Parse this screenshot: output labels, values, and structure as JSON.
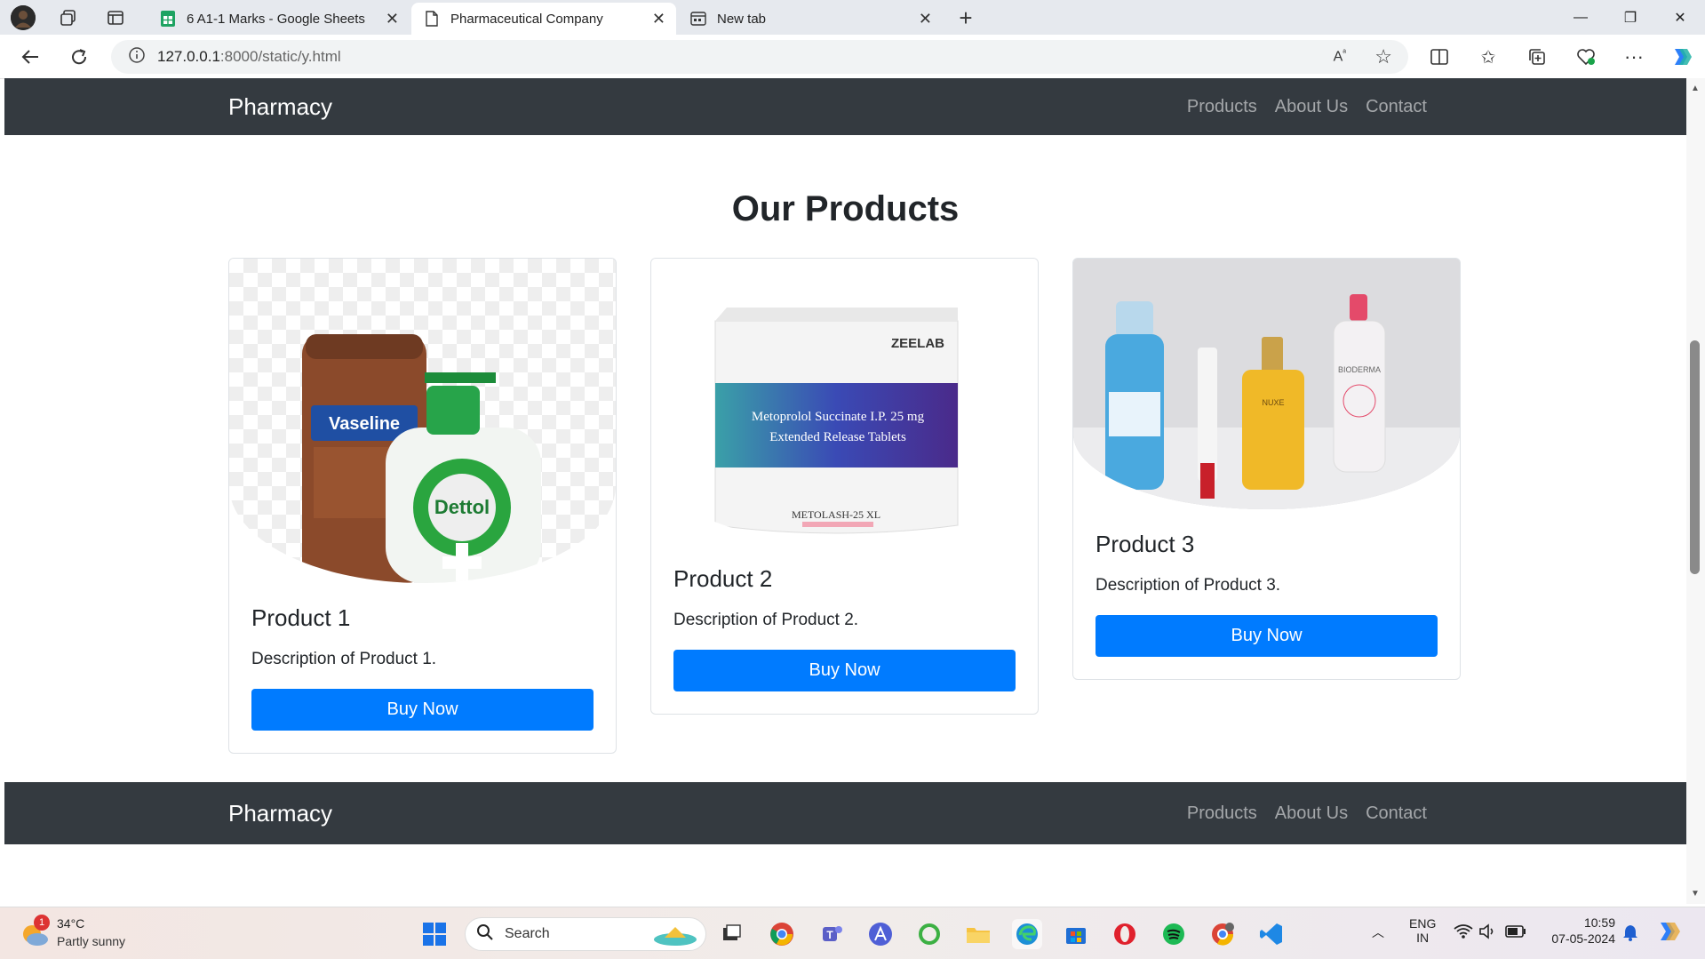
{
  "browser": {
    "tabs": [
      {
        "title": "6 A1-1 Marks - Google Sheets",
        "active": false
      },
      {
        "title": "Pharmaceutical Company",
        "active": true
      },
      {
        "title": "New tab",
        "active": false
      }
    ],
    "url_host": "127.0.0.1",
    "url_rest": ":8000/static/y.html"
  },
  "header": {
    "brand": "Pharmacy",
    "links": [
      "Products",
      "About Us",
      "Contact"
    ]
  },
  "main": {
    "title": "Our Products",
    "products": [
      {
        "name": "Product 1",
        "description": "Description of Product 1.",
        "button": "Buy Now",
        "image": "vaseline-dettol-photo"
      },
      {
        "name": "Product 2",
        "description": "Description of Product 2.",
        "button": "Buy Now",
        "image": "zeelab-metoprolol-box-photo"
      },
      {
        "name": "Product 3",
        "description": "Description of Product 3.",
        "button": "Buy Now",
        "image": "skincare-bottles-photo"
      }
    ]
  },
  "footer": {
    "brand": "Pharmacy",
    "links": [
      "Products",
      "About Us",
      "Contact"
    ]
  },
  "image_text": {
    "p1_brand1": "Vaseline",
    "p1_brand2": "Dettol",
    "p2_brand": "ZEELAB",
    "p2_drug": "Metoprolol Succinate I.P. 25 mg",
    "p2_release": "Extended Release Tablets",
    "p2_name": "METOLASH-25 XL",
    "p3_brand1": "NUXE",
    "p3_brand2": "BIODERMA"
  },
  "taskbar": {
    "weather_temp": "34°C",
    "weather_desc": "Partly sunny",
    "weather_badge": "1",
    "search_placeholder": "Search",
    "lang_1": "ENG",
    "lang_2": "IN",
    "time": "10:59",
    "date": "07-05-2024"
  },
  "colors": {
    "navbar": "#343a40",
    "button": "#007bff"
  }
}
